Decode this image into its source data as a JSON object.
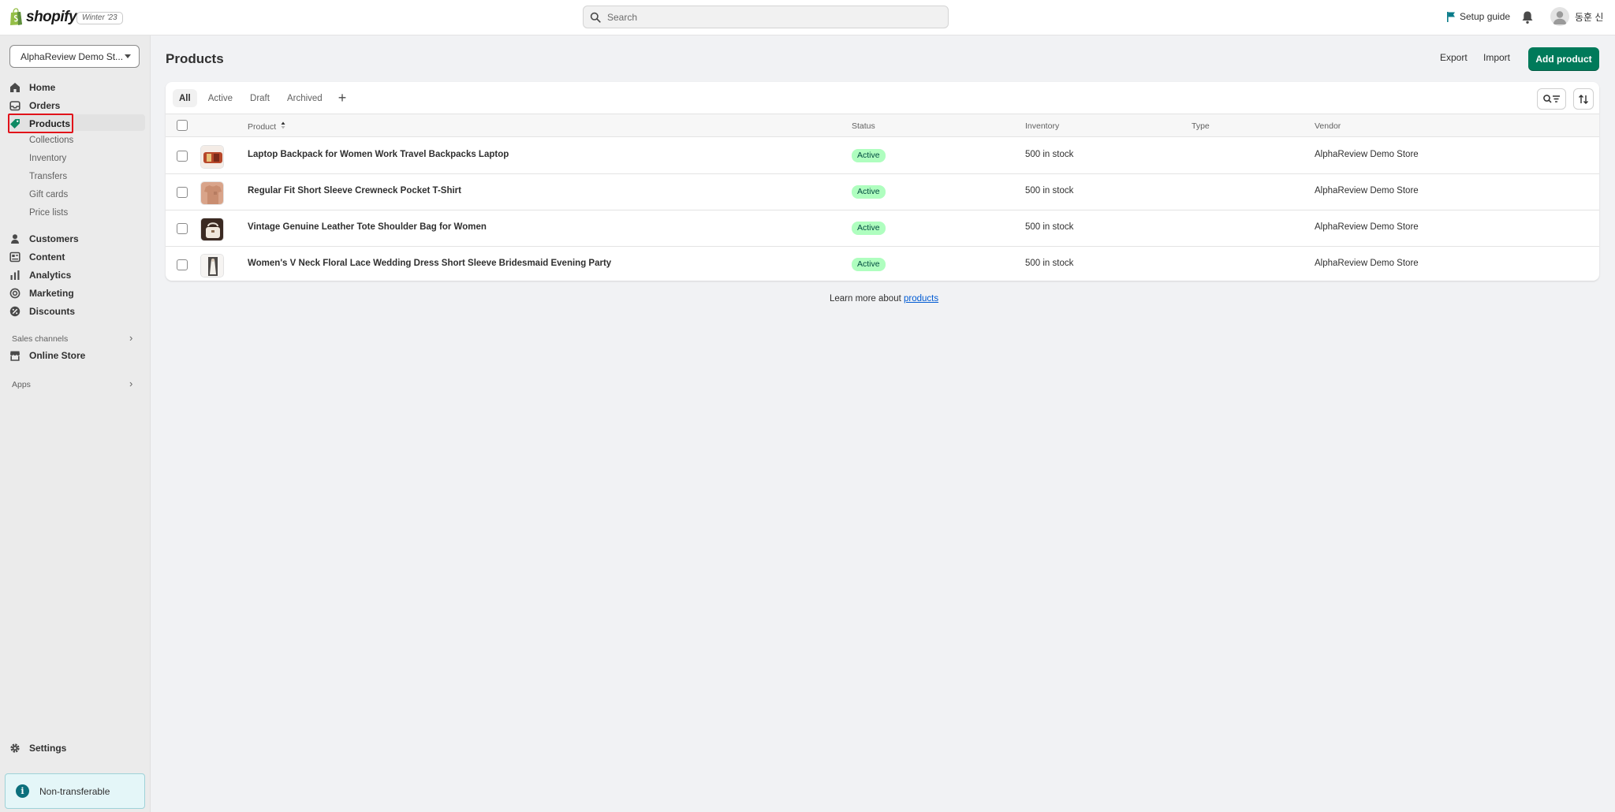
{
  "app": {
    "brand": "shopify",
    "release": "Winter '23"
  },
  "search": {
    "placeholder": "Search",
    "value": ""
  },
  "topbar": {
    "setup_guide": "Setup guide",
    "user_name": "동훈 신"
  },
  "sidebar": {
    "store_name": "AlphaReview Demo St...",
    "items": [
      {
        "label": "Home",
        "icon": "home-icon"
      },
      {
        "label": "Orders",
        "icon": "inbox-icon"
      },
      {
        "label": "Products",
        "icon": "tag-icon",
        "active": true
      },
      {
        "label": "Customers",
        "icon": "person-icon"
      },
      {
        "label": "Content",
        "icon": "content-icon"
      },
      {
        "label": "Analytics",
        "icon": "bar-chart-icon"
      },
      {
        "label": "Marketing",
        "icon": "target-icon"
      },
      {
        "label": "Discounts",
        "icon": "discount-icon"
      }
    ],
    "product_subitems": [
      "Collections",
      "Inventory",
      "Transfers",
      "Gift cards",
      "Price lists"
    ],
    "sales_channels_label": "Sales channels",
    "online_store": "Online Store",
    "apps_label": "Apps",
    "settings": "Settings",
    "non_transferable": "Non-transferable"
  },
  "page": {
    "title": "Products",
    "export_label": "Export",
    "import_label": "Import",
    "add_product_label": "Add product"
  },
  "tabs": [
    "All",
    "Active",
    "Draft",
    "Archived"
  ],
  "table": {
    "columns": [
      "Product",
      "Status",
      "Inventory",
      "Type",
      "Vendor"
    ],
    "rows": [
      {
        "name": "Laptop Backpack for Women Work Travel Backpacks Laptop",
        "status": "Active",
        "inventory": "500 in stock",
        "type": "",
        "vendor": "AlphaReview Demo Store"
      },
      {
        "name": "Regular Fit Short Sleeve Crewneck Pocket T-Shirt",
        "status": "Active",
        "inventory": "500 in stock",
        "type": "",
        "vendor": "AlphaReview Demo Store"
      },
      {
        "name": "Vintage Genuine Leather Tote Shoulder Bag for Women",
        "status": "Active",
        "inventory": "500 in stock",
        "type": "",
        "vendor": "AlphaReview Demo Store"
      },
      {
        "name": "Women's V Neck Floral Lace Wedding Dress Short Sleeve Bridesmaid Evening Party",
        "status": "Active",
        "inventory": "500 in stock",
        "type": "",
        "vendor": "AlphaReview Demo Store"
      }
    ]
  },
  "footer": {
    "learn_more_prefix": "Learn more about ",
    "learn_more_link": "products"
  },
  "colors": {
    "primary_button": "#007a5a",
    "active_badge": "#affebf",
    "highlight_box": "#e1121a",
    "link": "#005bd3"
  }
}
